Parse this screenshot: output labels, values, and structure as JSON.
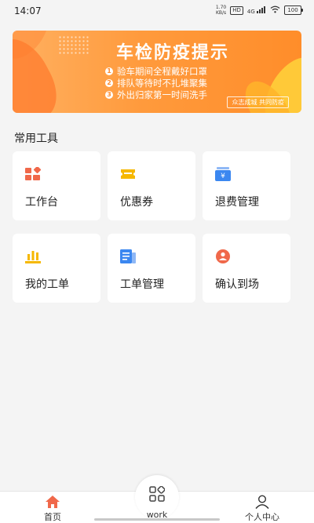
{
  "status_bar": {
    "time": "14:07",
    "net_speed": "1.70",
    "net_unit": "KB/s",
    "hd": "HD",
    "signal": "4G",
    "battery": "100"
  },
  "banner": {
    "title": "车检防疫提示",
    "tips": [
      {
        "num": "1",
        "text": "验车期间全程戴好口罩"
      },
      {
        "num": "2",
        "text": "排队等待时不扎堆聚集"
      },
      {
        "num": "3",
        "text": "外出归家第一时间洗手"
      }
    ],
    "slogan": "众志成城 共同防疫",
    "colors": {
      "start": "#ffb060",
      "end": "#ff8d2a"
    }
  },
  "tools": {
    "title": "常用工具",
    "items": [
      {
        "label": "工作台",
        "icon": "workbench-icon",
        "color": "#f0684a"
      },
      {
        "label": "优惠券",
        "icon": "coupon-icon",
        "color": "#f6b800"
      },
      {
        "label": "退费管理",
        "icon": "refund-icon",
        "color": "#3b87f0"
      },
      {
        "label": "我的工单",
        "icon": "chart-icon",
        "color": "#f6b800"
      },
      {
        "label": "工单管理",
        "icon": "document-icon",
        "color": "#3b87f0"
      },
      {
        "label": "确认到场",
        "icon": "person-check-icon",
        "color": "#f0684a"
      }
    ]
  },
  "bottom_nav": {
    "items": [
      {
        "label": "首页",
        "icon": "home-icon",
        "active": true,
        "color": "#f0684a"
      },
      {
        "label": "work",
        "icon": "grid-icon",
        "active": false
      },
      {
        "label": "个人中心",
        "icon": "user-icon",
        "active": false
      }
    ]
  }
}
